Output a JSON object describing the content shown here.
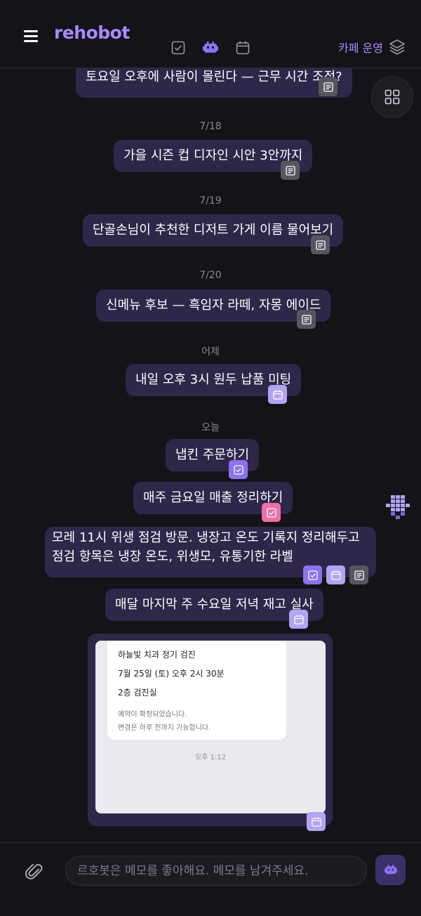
{
  "app": {
    "title": "rehobot"
  },
  "header": {
    "tabs": [
      {
        "name": "tasks",
        "icon": "checkbox-icon"
      },
      {
        "name": "robot",
        "icon": "robot-icon"
      },
      {
        "name": "calendar",
        "icon": "calendar-icon"
      }
    ],
    "workspace": "카페 운영"
  },
  "feed": {
    "messages": [
      {
        "text": "토요일 오후에 사람이 몰린다 — 근무 시간 조정?",
        "tags": [
          "memo"
        ]
      },
      {
        "date": "7/18",
        "text": "가을 시즌 컵 디자인 시안 3안까지",
        "tags": [
          "memo"
        ]
      },
      {
        "date": "7/19",
        "text": "단골손님이 추천한 디저트 가게 이름 물어보기",
        "tags": [
          "memo"
        ]
      },
      {
        "date": "7/20",
        "text": "신메뉴 후보 — 흑임자 라떼, 자몽 에이드",
        "tags": [
          "memo"
        ]
      },
      {
        "date": "어제",
        "text": "내일 오후 3시 원두 납품 미팅",
        "tags": [
          "calendar"
        ]
      },
      {
        "date": "오늘",
        "text": "냅킨 주문하기",
        "tags": [
          "task"
        ]
      },
      {
        "text": "매주 금요일 매출 정리하기",
        "tags": [
          "task-repeat"
        ]
      },
      {
        "text": "모레 11시 위생 점검 방문. 냉장고 온도 기록지 정리해두고 점검 항목은 냉장 온도, 위생모, 유통기한 라벨",
        "tags": [
          "task",
          "calendar",
          "memo"
        ]
      },
      {
        "text": "매달 마지막 주 수요일 저녁 재고 실사",
        "tags": [
          "calendar"
        ]
      }
    ],
    "card": {
      "line1": "하늘빛 치과 정기 검진",
      "line2": "7월 25일 (토) 오후 2시 30분",
      "line3": "2층 검진실",
      "note1": "예약이 확정되었습니다.",
      "note2": "변경은 하루 전까지 가능합니다.",
      "time": "오후 1:12",
      "tags": [
        "calendar"
      ]
    }
  },
  "composer": {
    "placeholder": "르호봇은 메모를 좋아해요. 메모를 남겨주세요.",
    "attach_icon": "paperclip-icon",
    "send_icon": "robot-icon"
  },
  "colors": {
    "accent": "#a78bfa",
    "bubble": "#2e2749",
    "background": "#141318",
    "memo_tag": "#575560",
    "task_tag": "#8b72ee",
    "calendar_tag": "#b3a3f4",
    "repeat_tag": "#ec6fa8"
  }
}
